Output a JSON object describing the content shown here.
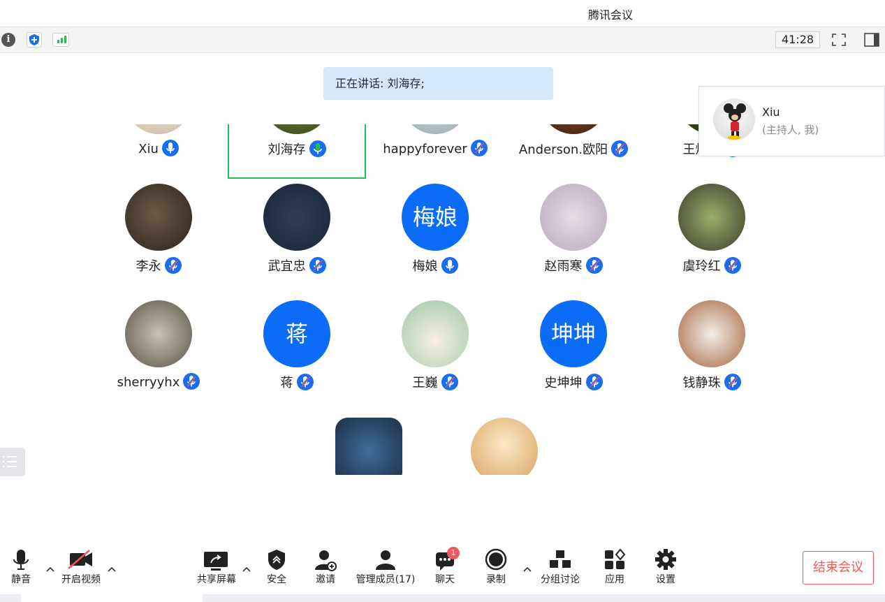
{
  "app": {
    "title": "腾讯会议"
  },
  "topbar": {
    "timer": "41:28"
  },
  "speaking": {
    "text": "正在讲话: 刘海存;"
  },
  "host_card": {
    "name": "Xiu",
    "role": "(主持人, 我)"
  },
  "participants": [
    {
      "name": "Xiu",
      "mic": "on",
      "avatar": "photo"
    },
    {
      "name": "刘海存",
      "mic": "speaking",
      "avatar": "photo"
    },
    {
      "name": "happyforever",
      "mic": "muted",
      "avatar": "photo"
    },
    {
      "name": "Anderson.欧阳",
      "mic": "muted",
      "avatar": "photo"
    },
    {
      "name": "王炳福",
      "mic": "muted",
      "avatar": "photo"
    },
    {
      "name": "李永",
      "mic": "muted",
      "avatar": "photo"
    },
    {
      "name": "武宜忠",
      "mic": "muted",
      "avatar": "photo"
    },
    {
      "name": "梅娘",
      "mic": "on",
      "avatar": "text",
      "avatar_text": "梅娘"
    },
    {
      "name": "赵雨寒",
      "mic": "muted",
      "avatar": "photo"
    },
    {
      "name": "虞玲红",
      "mic": "muted",
      "avatar": "photo"
    },
    {
      "name": "sherryyhx",
      "mic": "muted",
      "avatar": "photo"
    },
    {
      "name": "蒋",
      "mic": "muted",
      "avatar": "text",
      "avatar_text": "蒋"
    },
    {
      "name": "王巍",
      "mic": "muted",
      "avatar": "photo"
    },
    {
      "name": "史坤坤",
      "mic": "muted",
      "avatar": "text",
      "avatar_text": "坤坤"
    },
    {
      "name": "钱静珠",
      "mic": "muted",
      "avatar": "photo"
    }
  ],
  "toolbar": {
    "mute": "静音",
    "video": "开启视频",
    "share": "共享屏幕",
    "security": "安全",
    "invite": "邀请",
    "members": "管理成员(17)",
    "chat": "聊天",
    "chat_badge": "1",
    "record": "录制",
    "breakout": "分组讨论",
    "apps": "应用",
    "settings": "设置",
    "end": "结束会议"
  },
  "colors": {
    "accent": "#1a6cf2",
    "speaking": "#1fbf55",
    "end": "#f0565a",
    "banner": "#d5e7fb"
  }
}
